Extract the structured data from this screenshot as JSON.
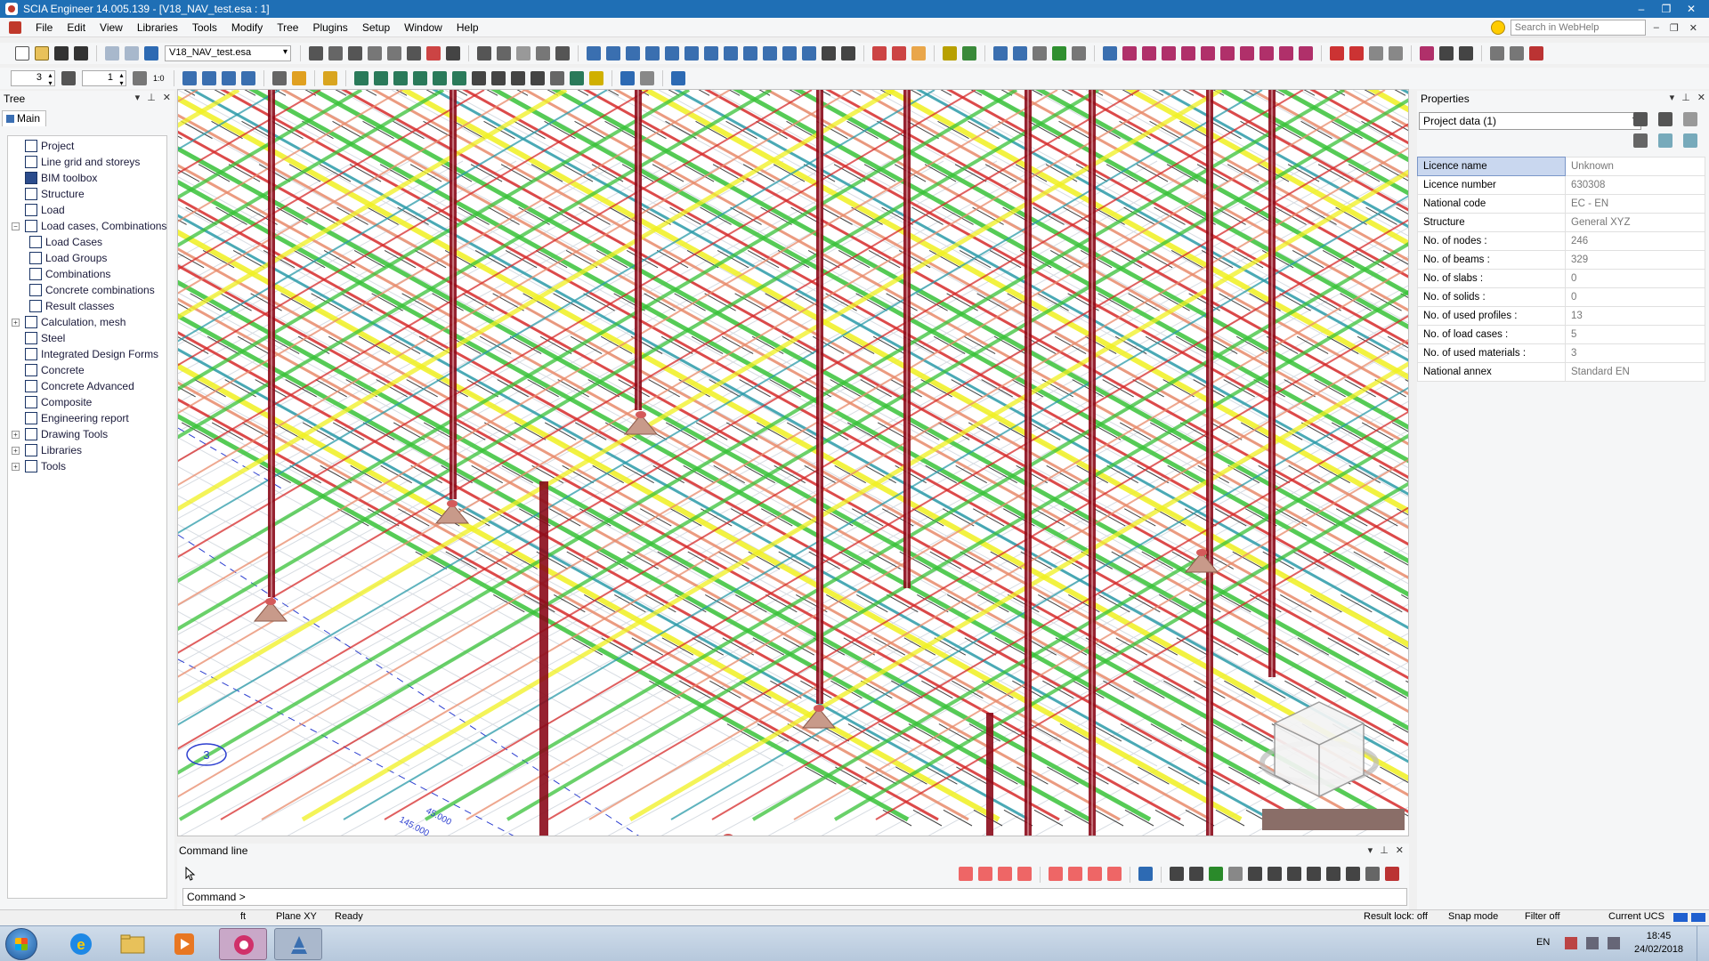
{
  "window": {
    "title": "SCIA Engineer 14.005.139 - [V18_NAV_test.esa : 1]",
    "controls": [
      "–",
      "❐",
      "✕"
    ]
  },
  "menu": {
    "items": [
      "File",
      "Edit",
      "View",
      "Libraries",
      "Tools",
      "Modify",
      "Tree",
      "Plugins",
      "Setup",
      "Window",
      "Help"
    ],
    "search_placeholder": "Search in WebHelp"
  },
  "toolbar": {
    "project_selector": "V18_NAV_test.esa",
    "spin_a": "3",
    "spin_b": "1",
    "ratio_label": "1:0"
  },
  "tree": {
    "title": "Tree",
    "tab": "Main",
    "items": [
      {
        "label": "Project",
        "expander": "",
        "indent": 0,
        "icon_color": "#ffffff"
      },
      {
        "label": "Line grid and storeys",
        "expander": "",
        "indent": 0,
        "icon_color": "#ffffff"
      },
      {
        "label": "BIM toolbox",
        "expander": "",
        "indent": 0,
        "icon_color": "#2b4c8c"
      },
      {
        "label": "Structure",
        "expander": "",
        "indent": 0,
        "icon_color": "#ffffff"
      },
      {
        "label": "Load",
        "expander": "",
        "indent": 0,
        "icon_color": "#ffffff"
      },
      {
        "label": "Load cases, Combinations",
        "expander": "−",
        "indent": 0,
        "icon_color": "#ffffff"
      },
      {
        "label": "Load Cases",
        "expander": "",
        "indent": 1,
        "icon_color": "#ffffff"
      },
      {
        "label": "Load Groups",
        "expander": "",
        "indent": 1,
        "icon_color": "#ffffff"
      },
      {
        "label": "Combinations",
        "expander": "",
        "indent": 1,
        "icon_color": "#ffffff"
      },
      {
        "label": "Concrete combinations",
        "expander": "",
        "indent": 1,
        "icon_color": "#ffffff"
      },
      {
        "label": "Result classes",
        "expander": "",
        "indent": 1,
        "icon_color": "#ffffff"
      },
      {
        "label": "Calculation, mesh",
        "expander": "+",
        "indent": 0,
        "icon_color": "#ffffff"
      },
      {
        "label": "Steel",
        "expander": "",
        "indent": 0,
        "icon_color": "#ffffff"
      },
      {
        "label": "Integrated Design Forms",
        "expander": "",
        "indent": 0,
        "icon_color": "#ffffff"
      },
      {
        "label": "Concrete",
        "expander": "",
        "indent": 0,
        "icon_color": "#ffffff"
      },
      {
        "label": "Concrete Advanced",
        "expander": "",
        "indent": 0,
        "icon_color": "#ffffff"
      },
      {
        "label": "Composite",
        "expander": "",
        "indent": 0,
        "icon_color": "#ffffff"
      },
      {
        "label": "Engineering report",
        "expander": "",
        "indent": 0,
        "icon_color": "#ffffff"
      },
      {
        "label": "Drawing Tools",
        "expander": "+",
        "indent": 0,
        "icon_color": "#ffffff"
      },
      {
        "label": "Libraries",
        "expander": "+",
        "indent": 0,
        "icon_color": "#ffffff"
      },
      {
        "label": "Tools",
        "expander": "+",
        "indent": 0,
        "icon_color": "#ffffff"
      }
    ]
  },
  "viewport": {
    "grid_label": "3",
    "dimension_1": "45.000",
    "dimension_2": "145.000",
    "colors": {
      "red": "#d62a2a",
      "salmon": "#e88a6a",
      "green": "#38c238",
      "yellow": "#f0f020",
      "teal": "#2a9aa8",
      "black": "#111111",
      "darkred": "#8b0a1a"
    }
  },
  "command": {
    "title": "Command line",
    "prompt": "Command >"
  },
  "properties": {
    "title": "Properties",
    "selector": "Project data (1)",
    "rows": [
      {
        "name": "Licence name",
        "value": "Unknown"
      },
      {
        "name": "Licence number",
        "value": "630308"
      },
      {
        "name": "National code",
        "value": "EC - EN"
      },
      {
        "name": "Structure",
        "value": "General XYZ"
      },
      {
        "name": "No. of nodes :",
        "value": "246"
      },
      {
        "name": "No. of beams :",
        "value": "329"
      },
      {
        "name": "No. of slabs :",
        "value": "0"
      },
      {
        "name": "No. of solids :",
        "value": "0"
      },
      {
        "name": "No. of used profiles :",
        "value": "13"
      },
      {
        "name": "No. of load cases :",
        "value": "5"
      },
      {
        "name": "No. of used materials :",
        "value": "3"
      },
      {
        "name": "National annex",
        "value": "Standard EN"
      }
    ]
  },
  "status": {
    "units": "ft",
    "plane": "Plane XY",
    "state": "Ready",
    "result_lock": "Result lock: off",
    "snap_mode": "Snap mode",
    "filter": "Filter off",
    "ucs": "Current UCS"
  },
  "taskbar": {
    "language": "EN",
    "time": "18:45",
    "date": "24/02/2018"
  }
}
